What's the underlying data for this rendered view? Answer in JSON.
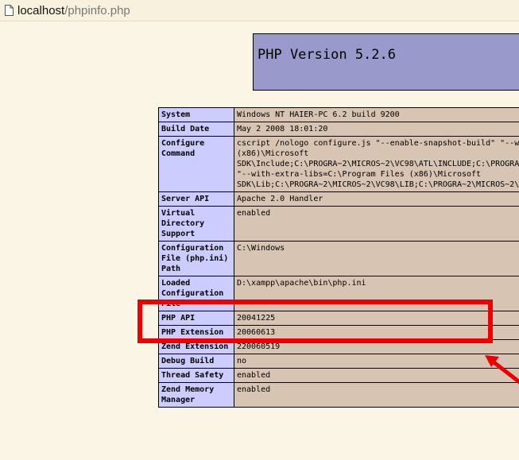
{
  "browser": {
    "url_host": "localhost",
    "url_path": "/phpinfo.php"
  },
  "header": {
    "title": "PHP Version 5.2.6"
  },
  "rows": [
    {
      "key": "System",
      "value": [
        "Windows NT HAIER-PC 6.2 build 9200"
      ]
    },
    {
      "key": "Build Date",
      "value": [
        "May 2 2008 18:01:20"
      ]
    },
    {
      "key": "Configure Command",
      "value": [
        "cscript /nologo configure.js \"--enable-snapshot-build\" \"--w",
        "(x86)\\Microsoft",
        "SDK\\Include;C:\\PROGRA~2\\MICROS~2\\VC98\\ATL\\INCLUDE;C:\\PROGRAT",
        "\"--with-extra-libs=C:\\Program Files (x86)\\Microsoft",
        "SDK\\Lib;C:\\PROGRA~2\\MICROS~2\\VC98\\LIB;C:\\PROGRA~2\\MICROS~2\\"
      ]
    },
    {
      "key": "Server API",
      "value": [
        "Apache 2.0 Handler"
      ]
    },
    {
      "key": "Virtual Directory Support",
      "value": [
        "enabled"
      ]
    },
    {
      "key": "Configuration File (php.ini) Path",
      "value": [
        "C:\\Windows"
      ]
    },
    {
      "key": "Loaded Configuration File",
      "value": [
        "D:\\xampp\\apache\\bin\\php.ini"
      ]
    },
    {
      "key": "PHP API",
      "value": [
        "20041225"
      ]
    },
    {
      "key": "PHP Extension",
      "value": [
        "20060613"
      ]
    },
    {
      "key": "Zend Extension",
      "value": [
        "220060519"
      ]
    },
    {
      "key": "Debug Build",
      "value": [
        "no"
      ]
    },
    {
      "key": "Thread Safety",
      "value": [
        "enabled"
      ]
    },
    {
      "key": "Zend Memory Manager",
      "value": [
        "enabled"
      ]
    }
  ],
  "colors": {
    "page_background": "#fbf5e6",
    "header_background": "#9999cc",
    "key_cell": "#ccccff",
    "value_cell": "#d8c4b2",
    "annotation": "#ee0000"
  }
}
